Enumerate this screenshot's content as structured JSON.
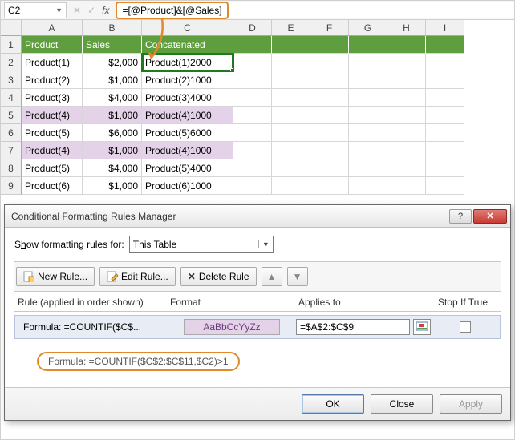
{
  "formula_bar": {
    "name_box": "C2",
    "fx_label": "fx",
    "formula": "=[@Product]&[@Sales]"
  },
  "columns": {
    "A": "A",
    "B": "B",
    "C": "C",
    "D": "D",
    "E": "E",
    "F": "F",
    "G": "G",
    "H": "H",
    "I": "I"
  },
  "table": {
    "headers": {
      "a": "Product",
      "b": "Sales",
      "c": "Concatenated"
    },
    "rows": [
      {
        "r": "2",
        "a": "Product(1)",
        "b": "$2,000",
        "c": "Product(1)2000",
        "hl": false
      },
      {
        "r": "3",
        "a": "Product(2)",
        "b": "$1,000",
        "c": "Product(2)1000",
        "hl": false
      },
      {
        "r": "4",
        "a": "Product(3)",
        "b": "$4,000",
        "c": "Product(3)4000",
        "hl": false
      },
      {
        "r": "5",
        "a": "Product(4)",
        "b": "$1,000",
        "c": "Product(4)1000",
        "hl": true
      },
      {
        "r": "6",
        "a": "Product(5)",
        "b": "$6,000",
        "c": "Product(5)6000",
        "hl": false
      },
      {
        "r": "7",
        "a": "Product(4)",
        "b": "$1,000",
        "c": "Product(4)1000",
        "hl": true
      },
      {
        "r": "8",
        "a": "Product(5)",
        "b": "$4,000",
        "c": "Product(5)4000",
        "hl": false
      },
      {
        "r": "9",
        "a": "Product(6)",
        "b": "$1,000",
        "c": "Product(6)1000",
        "hl": false
      }
    ]
  },
  "dialog": {
    "title": "Conditional Formatting Rules Manager",
    "show_label_pre": "S",
    "show_label_u": "h",
    "show_label_post": "ow formatting rules for:",
    "show_value": "This Table",
    "new_rule": "New Rule...",
    "edit_rule": "Edit Rule...",
    "delete_rule": "Delete Rule",
    "col_rule": "Rule (applied in order shown)",
    "col_format": "Format",
    "col_applies": "Applies to",
    "col_stop": "Stop If True",
    "rule_text": "Formula: =COUNTIF($C$...",
    "format_preview": "AaBbCcYyZz",
    "applies_to": "=$A$2:$C$9",
    "rule_full": "Formula: =COUNTIF($C$2:$C$11,$C2)>1",
    "ok": "OK",
    "close": "Close",
    "apply": "Apply"
  }
}
